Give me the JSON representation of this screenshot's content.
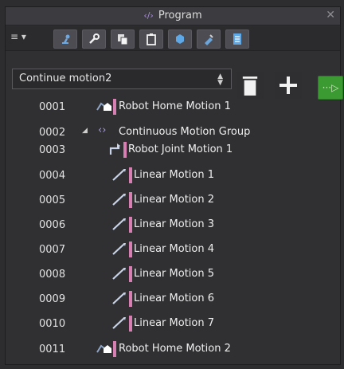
{
  "panel": {
    "title": "Program",
    "close": "✕"
  },
  "toolbar": {
    "menu": "≡ ▾"
  },
  "program_select": {
    "value": "Continue motion2",
    "arrows": "▲▼"
  },
  "rows": [
    {
      "num": "0001",
      "label": "Robot Home Motion 1",
      "kind": "home"
    },
    {
      "num": "0002",
      "label": "Continuous Motion Group",
      "kind": "group"
    },
    {
      "num": "0003",
      "label": "Robot Joint Motion 1",
      "kind": "joint"
    },
    {
      "num": "0004",
      "label": "Linear Motion 1",
      "kind": "linear"
    },
    {
      "num": "0005",
      "label": "Linear Motion 2",
      "kind": "linear"
    },
    {
      "num": "0006",
      "label": "Linear Motion 3",
      "kind": "linear"
    },
    {
      "num": "0007",
      "label": "Linear Motion 4",
      "kind": "linear"
    },
    {
      "num": "0008",
      "label": "Linear Motion 5",
      "kind": "linear"
    },
    {
      "num": "0009",
      "label": "Linear Motion 6",
      "kind": "linear"
    },
    {
      "num": "0010",
      "label": "Linear Motion 7",
      "kind": "linear"
    },
    {
      "num": "0011",
      "label": "Robot Home Motion 2",
      "kind": "home"
    }
  ]
}
